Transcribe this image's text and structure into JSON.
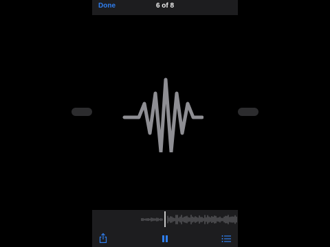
{
  "header": {
    "done_label": "Done",
    "title": "6 of 8"
  },
  "player": {
    "state": "playing"
  },
  "icons": {
    "waveform": "waveform-icon",
    "share": "share-icon",
    "pause": "pause-icon",
    "list": "list-icon"
  },
  "colors": {
    "accent": "#2f7ff0",
    "waveform": "#8e8e93",
    "playhead": "#ffffff"
  }
}
